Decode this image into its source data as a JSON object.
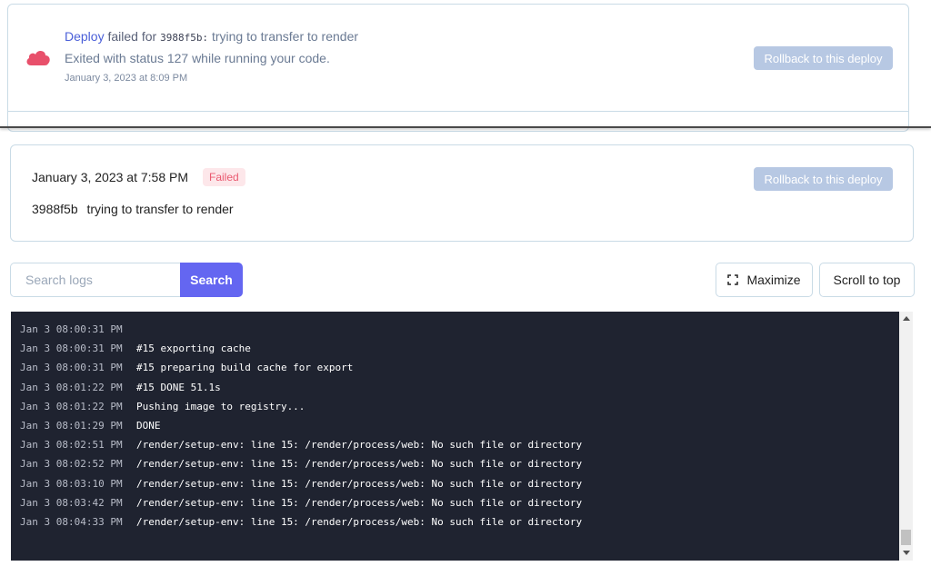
{
  "event": {
    "deploy_link": "Deploy",
    "failed_text": "failed for",
    "commit_hash": "3988f5b:",
    "commit_message": "trying to transfer to render",
    "status_message": "Exited with status 127 while running your code.",
    "timestamp": "January 3, 2023 at 8:09 PM",
    "rollback_label": "Rollback to this deploy",
    "icon": "cloud-icon",
    "icon_color": "#e8506b"
  },
  "deploy": {
    "date": "January 3, 2023 at 7:58 PM",
    "status_badge": "Failed",
    "commit_hash": "3988f5b",
    "commit_message": "trying to transfer to render",
    "rollback_label": "Rollback to this deploy"
  },
  "toolbar": {
    "search_placeholder": "Search logs",
    "search_value": "",
    "search_button": "Search",
    "maximize_label": "Maximize",
    "maximize_icon": "maximize-icon",
    "scroll_top_label": "Scroll to top"
  },
  "logs": [
    {
      "time": "Jan 3 08:00:31 PM",
      "message": ""
    },
    {
      "time": "Jan 3 08:00:31 PM",
      "message": "#15 exporting cache"
    },
    {
      "time": "Jan 3 08:00:31 PM",
      "message": "#15 preparing build cache for export"
    },
    {
      "time": "Jan 3 08:01:22 PM",
      "message": "#15 DONE 51.1s"
    },
    {
      "time": "Jan 3 08:01:22 PM",
      "message": "Pushing image to registry..."
    },
    {
      "time": "Jan 3 08:01:29 PM",
      "message": "DONE"
    },
    {
      "time": "Jan 3 08:02:51 PM",
      "message": "/render/setup-env: line 15: /render/process/web: No such file or directory"
    },
    {
      "time": "Jan 3 08:02:52 PM",
      "message": "/render/setup-env: line 15: /render/process/web: No such file or directory"
    },
    {
      "time": "Jan 3 08:03:10 PM",
      "message": "/render/setup-env: line 15: /render/process/web: No such file or directory"
    },
    {
      "time": "Jan 3 08:03:42 PM",
      "message": "/render/setup-env: line 15: /render/process/web: No such file or directory"
    },
    {
      "time": "Jan 3 08:04:33 PM",
      "message": "/render/setup-env: line 15: /render/process/web: No such file or directory"
    }
  ],
  "colors": {
    "accent": "#6466f1",
    "link": "#4a5fd8",
    "rollback_disabled": "#b7c8e3",
    "failed_badge_bg": "#fde7ea",
    "failed_badge_text": "#ea5a70",
    "log_bg": "#1f2330"
  }
}
